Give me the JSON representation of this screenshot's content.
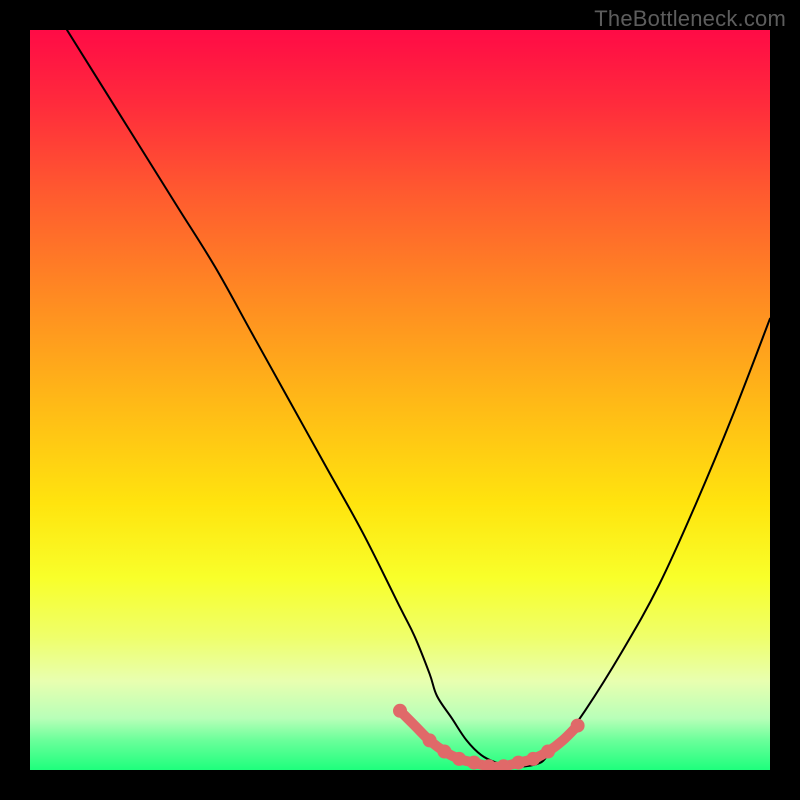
{
  "watermark": "TheBottleneck.com",
  "chart_data": {
    "type": "line",
    "title": "",
    "xlabel": "",
    "ylabel": "",
    "xlim": [
      0,
      100
    ],
    "ylim": [
      0,
      100
    ],
    "grid": false,
    "series": [
      {
        "name": "curve",
        "color": "#000000",
        "x": [
          5,
          10,
          15,
          20,
          25,
          30,
          35,
          40,
          45,
          50,
          52,
          54,
          55,
          57,
          59,
          61,
          63,
          65,
          67,
          69,
          70,
          72,
          75,
          80,
          85,
          90,
          95,
          100
        ],
        "y": [
          100,
          92,
          84,
          76,
          68,
          59,
          50,
          41,
          32,
          22,
          18,
          13,
          10,
          7,
          4,
          2,
          1,
          0.5,
          0.5,
          1,
          2,
          4,
          8,
          16,
          25,
          36,
          48,
          61
        ]
      },
      {
        "name": "bottom-highlight",
        "color": "#e06969",
        "x": [
          50,
          52,
          54,
          56,
          58,
          60,
          62,
          64,
          66,
          68,
          70,
          72,
          74
        ],
        "y": [
          8,
          6,
          4,
          2.5,
          1.5,
          1,
          0.5,
          0.5,
          1,
          1.5,
          2.5,
          4,
          6
        ]
      }
    ],
    "markers": [
      {
        "x": 50,
        "y": 8,
        "color": "#e06969"
      },
      {
        "x": 54,
        "y": 4,
        "color": "#e06969"
      },
      {
        "x": 56,
        "y": 2.5,
        "color": "#e06969"
      },
      {
        "x": 58,
        "y": 1.5,
        "color": "#e06969"
      },
      {
        "x": 60,
        "y": 1,
        "color": "#e06969"
      },
      {
        "x": 62,
        "y": 0.5,
        "color": "#e06969"
      },
      {
        "x": 64,
        "y": 0.5,
        "color": "#e06969"
      },
      {
        "x": 66,
        "y": 1,
        "color": "#e06969"
      },
      {
        "x": 68,
        "y": 1.5,
        "color": "#e06969"
      },
      {
        "x": 70,
        "y": 2.5,
        "color": "#e06969"
      },
      {
        "x": 74,
        "y": 6,
        "color": "#e06969"
      }
    ]
  }
}
